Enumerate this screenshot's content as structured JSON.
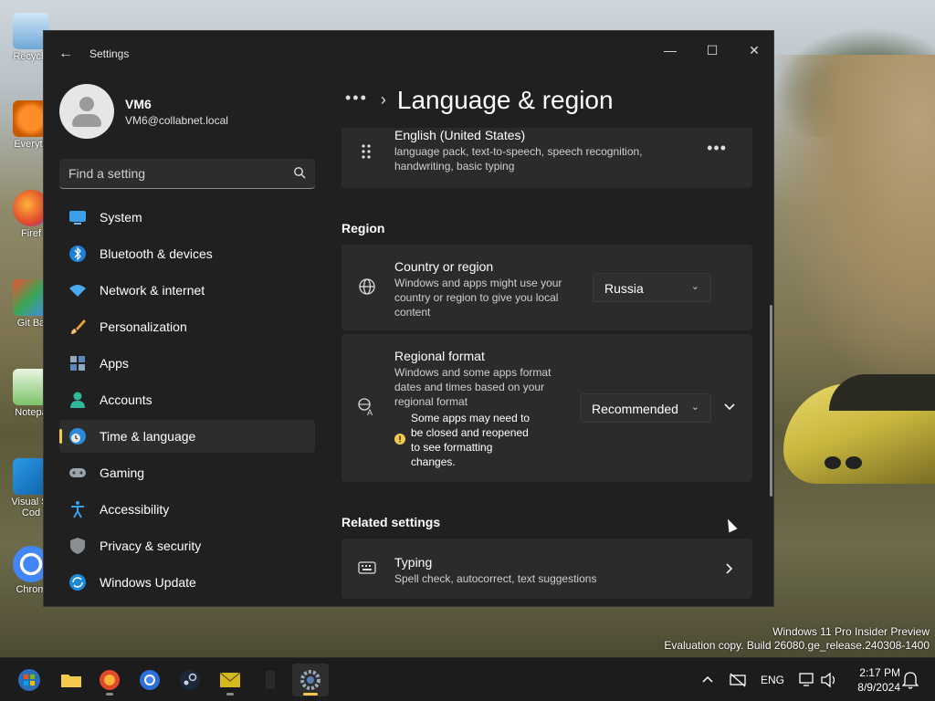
{
  "window": {
    "title": "Settings",
    "minimize_glyph": "—",
    "maximize_glyph": "☐",
    "close_glyph": "✕",
    "back_glyph": "←"
  },
  "user": {
    "name": "VM6",
    "email": "VM6@collabnet.local"
  },
  "search": {
    "placeholder": "Find a setting"
  },
  "sidebar": {
    "items": [
      {
        "label": "System",
        "icon": "monitor-icon"
      },
      {
        "label": "Bluetooth & devices",
        "icon": "bluetooth-icon"
      },
      {
        "label": "Network & internet",
        "icon": "wifi-icon"
      },
      {
        "label": "Personalization",
        "icon": "paintbrush-icon"
      },
      {
        "label": "Apps",
        "icon": "apps-icon"
      },
      {
        "label": "Accounts",
        "icon": "person-icon"
      },
      {
        "label": "Time & language",
        "icon": "clock-globe-icon",
        "active": true
      },
      {
        "label": "Gaming",
        "icon": "gamepad-icon"
      },
      {
        "label": "Accessibility",
        "icon": "accessibility-icon"
      },
      {
        "label": "Privacy & security",
        "icon": "shield-icon"
      },
      {
        "label": "Windows Update",
        "icon": "update-icon"
      }
    ]
  },
  "header": {
    "breadcrumb_dots": "•••",
    "breadcrumb_chevron": "›",
    "title": "Language & region"
  },
  "language_card": {
    "title": "English (United States)",
    "subtitle_line1": "language pack, text-to-speech, speech recognition,",
    "subtitle_line2": "handwriting, basic typing",
    "more": "•••"
  },
  "region": {
    "section_title": "Region",
    "country": {
      "title": "Country or region",
      "desc_line1": "Windows and apps might use your",
      "desc_line2": "country or region to give you local",
      "desc_line3": "content",
      "value": "Russia"
    },
    "format": {
      "title": "Regional format",
      "desc_line1": "Windows and some apps format",
      "desc_line2": "dates and times based on your",
      "desc_line3": "regional format",
      "warning_line1": "Some apps may need to",
      "warning_line2": "be closed and reopened",
      "warning_line3": "to see formatting",
      "warning_line4": "changes.",
      "value": "Recommended"
    }
  },
  "related": {
    "section_title": "Related settings",
    "typing": {
      "title": "Typing",
      "subtitle": "Spell check, autocorrect, text suggestions"
    }
  },
  "desktop": {
    "icons": [
      "Recycle",
      "Everyth",
      "Firef",
      "Git Ba",
      "Notepa",
      "Visual St Cod",
      "Chrom"
    ],
    "watermark_line1": "Windows 11 Pro Insider Preview",
    "watermark_line2": "Evaluation copy. Build 26080.ge_release.240308-1400"
  },
  "taskbar": {
    "language": "ENG",
    "time": "2:17 PM",
    "date": "8/9/2024",
    "accent": "#f2c94c"
  }
}
